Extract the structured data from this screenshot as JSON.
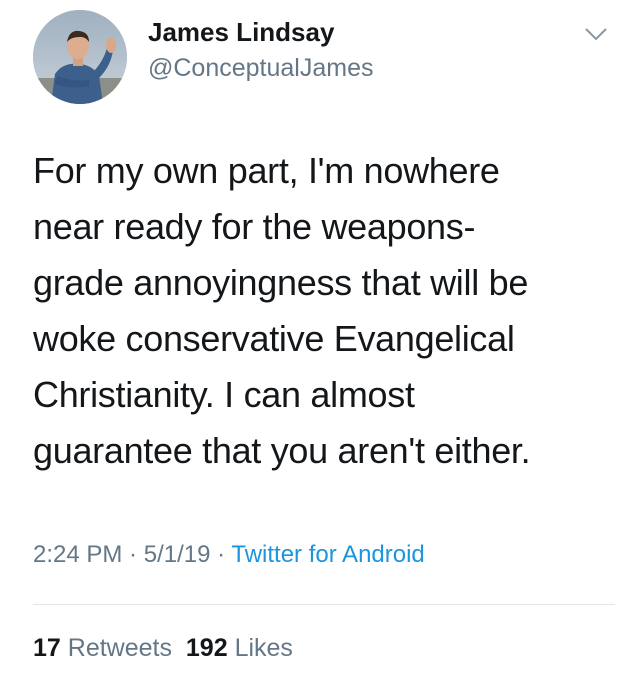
{
  "author": {
    "display_name": "James Lindsay",
    "handle": "@ConceptualJames",
    "avatar_icon": "profile-photo-avatar"
  },
  "menu_icon": "chevron-down-icon",
  "tweet": {
    "lines": [
      "For my own part, I'm nowhere",
      "near ready for the weapons-",
      "grade annoyingness that will be",
      "woke conservative Evangelical",
      "Christianity. I can almost",
      "guarantee that you aren't either."
    ]
  },
  "meta": {
    "time": "2:24 PM",
    "separator": " · ",
    "date": "5/1/19",
    "source": "Twitter for Android"
  },
  "stats": {
    "retweets_count": "17",
    "retweets_label": "Retweets",
    "likes_count": "192",
    "likes_label": "Likes"
  },
  "colors": {
    "text_primary": "#14171a",
    "text_secondary": "#657786",
    "link": "#1b95e0",
    "divider": "#e1e8ed"
  }
}
